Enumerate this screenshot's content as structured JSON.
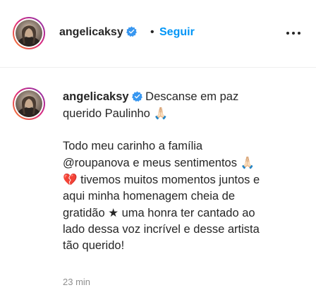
{
  "header": {
    "username": "angelicaksy",
    "separator": "•",
    "follow_label": "Seguir",
    "more_icon": "more-horizontal-icon"
  },
  "caption": {
    "username": "angelicaksy",
    "line1_text": "Descanse em paz",
    "line2_text": "querido Paulinho",
    "line2_emoji": "🙏🏻",
    "para2_l1": "Todo meu carinho a família",
    "para2_l2_mention": "@roupanova",
    "para2_l2_rest": " e meus sentimentos",
    "para2_l2_emoji": "🙏🏻",
    "para2_l3_emoji": "💔",
    "para2_l3_text": " tivemos muitos momentos juntos e",
    "para2_l4": "aqui minha homenagem cheia de",
    "para2_l5_a": "gratidão ",
    "para2_l5_star": "★",
    "para2_l5_b": " uma honra ter cantado ao",
    "para2_l6": "lado dessa voz incrível e desse artista",
    "para2_l7": "tão querido!"
  },
  "timestamp": "23 min",
  "colors": {
    "accent": "#0095f6",
    "text": "#262626",
    "muted": "#8e8e8e",
    "border": "#efefef"
  }
}
